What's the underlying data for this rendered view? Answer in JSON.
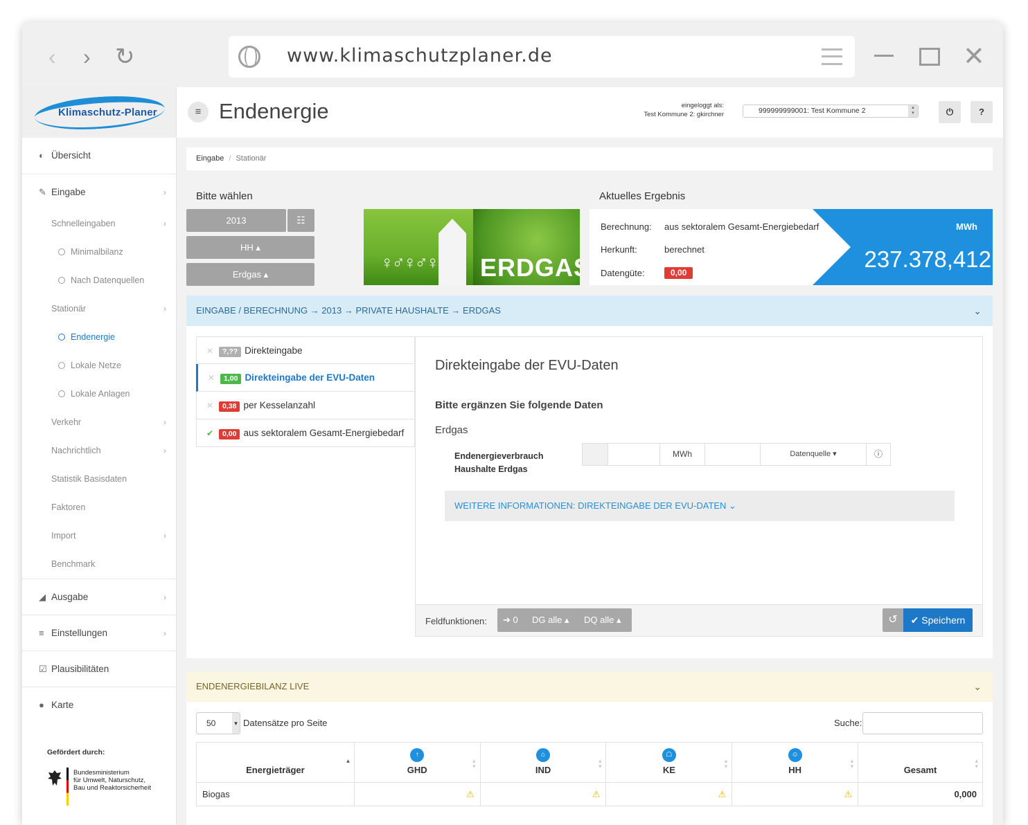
{
  "browser": {
    "url": "www.klimaschutzplaner.de",
    "back_icon": "back-arrow-icon",
    "forward_icon": "forward-arrow-icon",
    "reload_icon": "reload-icon"
  },
  "logo": {
    "text": "Klimaschutz-Planer"
  },
  "sidebar": {
    "items": [
      {
        "label": "Übersicht"
      },
      {
        "label": "Eingabe"
      },
      {
        "label": "Schnelleingaben"
      },
      {
        "label": "Minimalbilanz"
      },
      {
        "label": "Nach Datenquellen"
      },
      {
        "label": "Stationär"
      },
      {
        "label": "Endenergie"
      },
      {
        "label": "Lokale Netze"
      },
      {
        "label": "Lokale Anlagen"
      },
      {
        "label": "Verkehr"
      },
      {
        "label": "Nachrichtlich"
      },
      {
        "label": "Statistik Basisdaten"
      },
      {
        "label": "Faktoren"
      },
      {
        "label": "Import"
      },
      {
        "label": "Benchmark"
      },
      {
        "label": "Ausgabe"
      },
      {
        "label": "Einstellungen"
      },
      {
        "label": "Plausibilitäten"
      },
      {
        "label": "Karte"
      }
    ],
    "sponsor_title": "Gefördert durch:",
    "ministry_line1": "Bundesministerium",
    "ministry_line2": "für Umwelt, Naturschutz,",
    "ministry_line3": "Bau und Reaktorsicherheit"
  },
  "header": {
    "title": "Endenergie",
    "login_label": "eingeloggt als:",
    "login_user": "Test Kommune 2: gkirchner",
    "kommune": "999999999001: Test Kommune 2",
    "help": "?"
  },
  "breadcrumb": {
    "items": [
      "Eingabe",
      "Stationär"
    ],
    "separator": "/"
  },
  "selection": {
    "title": "Bitte wählen",
    "year": "2013",
    "sector": "HH ▴",
    "carrier": "Erdgas ▴"
  },
  "banner": {
    "word": "ERDGAS"
  },
  "result": {
    "title": "Aktuelles Ergebnis",
    "calc_label": "Berechnung:",
    "calc_value": "aus sektoralem Gesamt-Energiebedarf",
    "origin_label": "Herkunft:",
    "origin_value": "berechnet",
    "quality_label": "Datengüte:",
    "quality_value": "0,00",
    "unit": "MWh",
    "value": "237.378,412"
  },
  "input_panel": {
    "header": "EINGABE / BERECHNUNG → 2013 → PRIVATE HAUSHALTE → ERDGAS",
    "options": [
      {
        "badge": "?,??",
        "label": "Direkteingabe"
      },
      {
        "badge": "1,00",
        "label": "Direkteingabe der EVU-Daten"
      },
      {
        "badge": "0,38",
        "label": "per Kesselanzahl"
      },
      {
        "badge": "0,00",
        "label": "aus sektoralem Gesamt-Energiebedarf"
      }
    ],
    "form_title": "Direkteingabe der EVU-Daten",
    "form_subtitle": "Bitte ergänzen Sie folgende Daten",
    "category": "Erdgas",
    "field_label_1": "Endenergieverbrauch",
    "field_label_2": "Haushalte Erdgas",
    "unit": "MWh",
    "source_btn": "Datenquelle ▾",
    "more_info": "WEITERE INFORMATIONEN: DIREKTEINGABE DER EVU-DATEN ⌄",
    "field_functions_label": "Feldfunktionen:",
    "ff_zero": "➔ 0",
    "ff_dg": "DG alle ▴",
    "ff_dq": "DQ alle ▴",
    "save": "✔ Speichern"
  },
  "live_panel": {
    "header": "ENDENERGIEBILANZ LIVE",
    "page_size": "50",
    "per_page": "Datensätze pro Seite",
    "search_label": "Suche:",
    "columns": [
      "Energieträger",
      "GHD",
      "IND",
      "KE",
      "HH",
      "Gesamt"
    ],
    "rows": [
      {
        "name": "Biogas",
        "total": "0,000"
      }
    ]
  },
  "colors": {
    "accent": "#1e78c8",
    "result_blue": "#1e90de",
    "badge_red": "#e03b35",
    "badge_green": "#4cb84a",
    "panel_blue": "#d8ecf7",
    "panel_yellow": "#faf6e1"
  }
}
